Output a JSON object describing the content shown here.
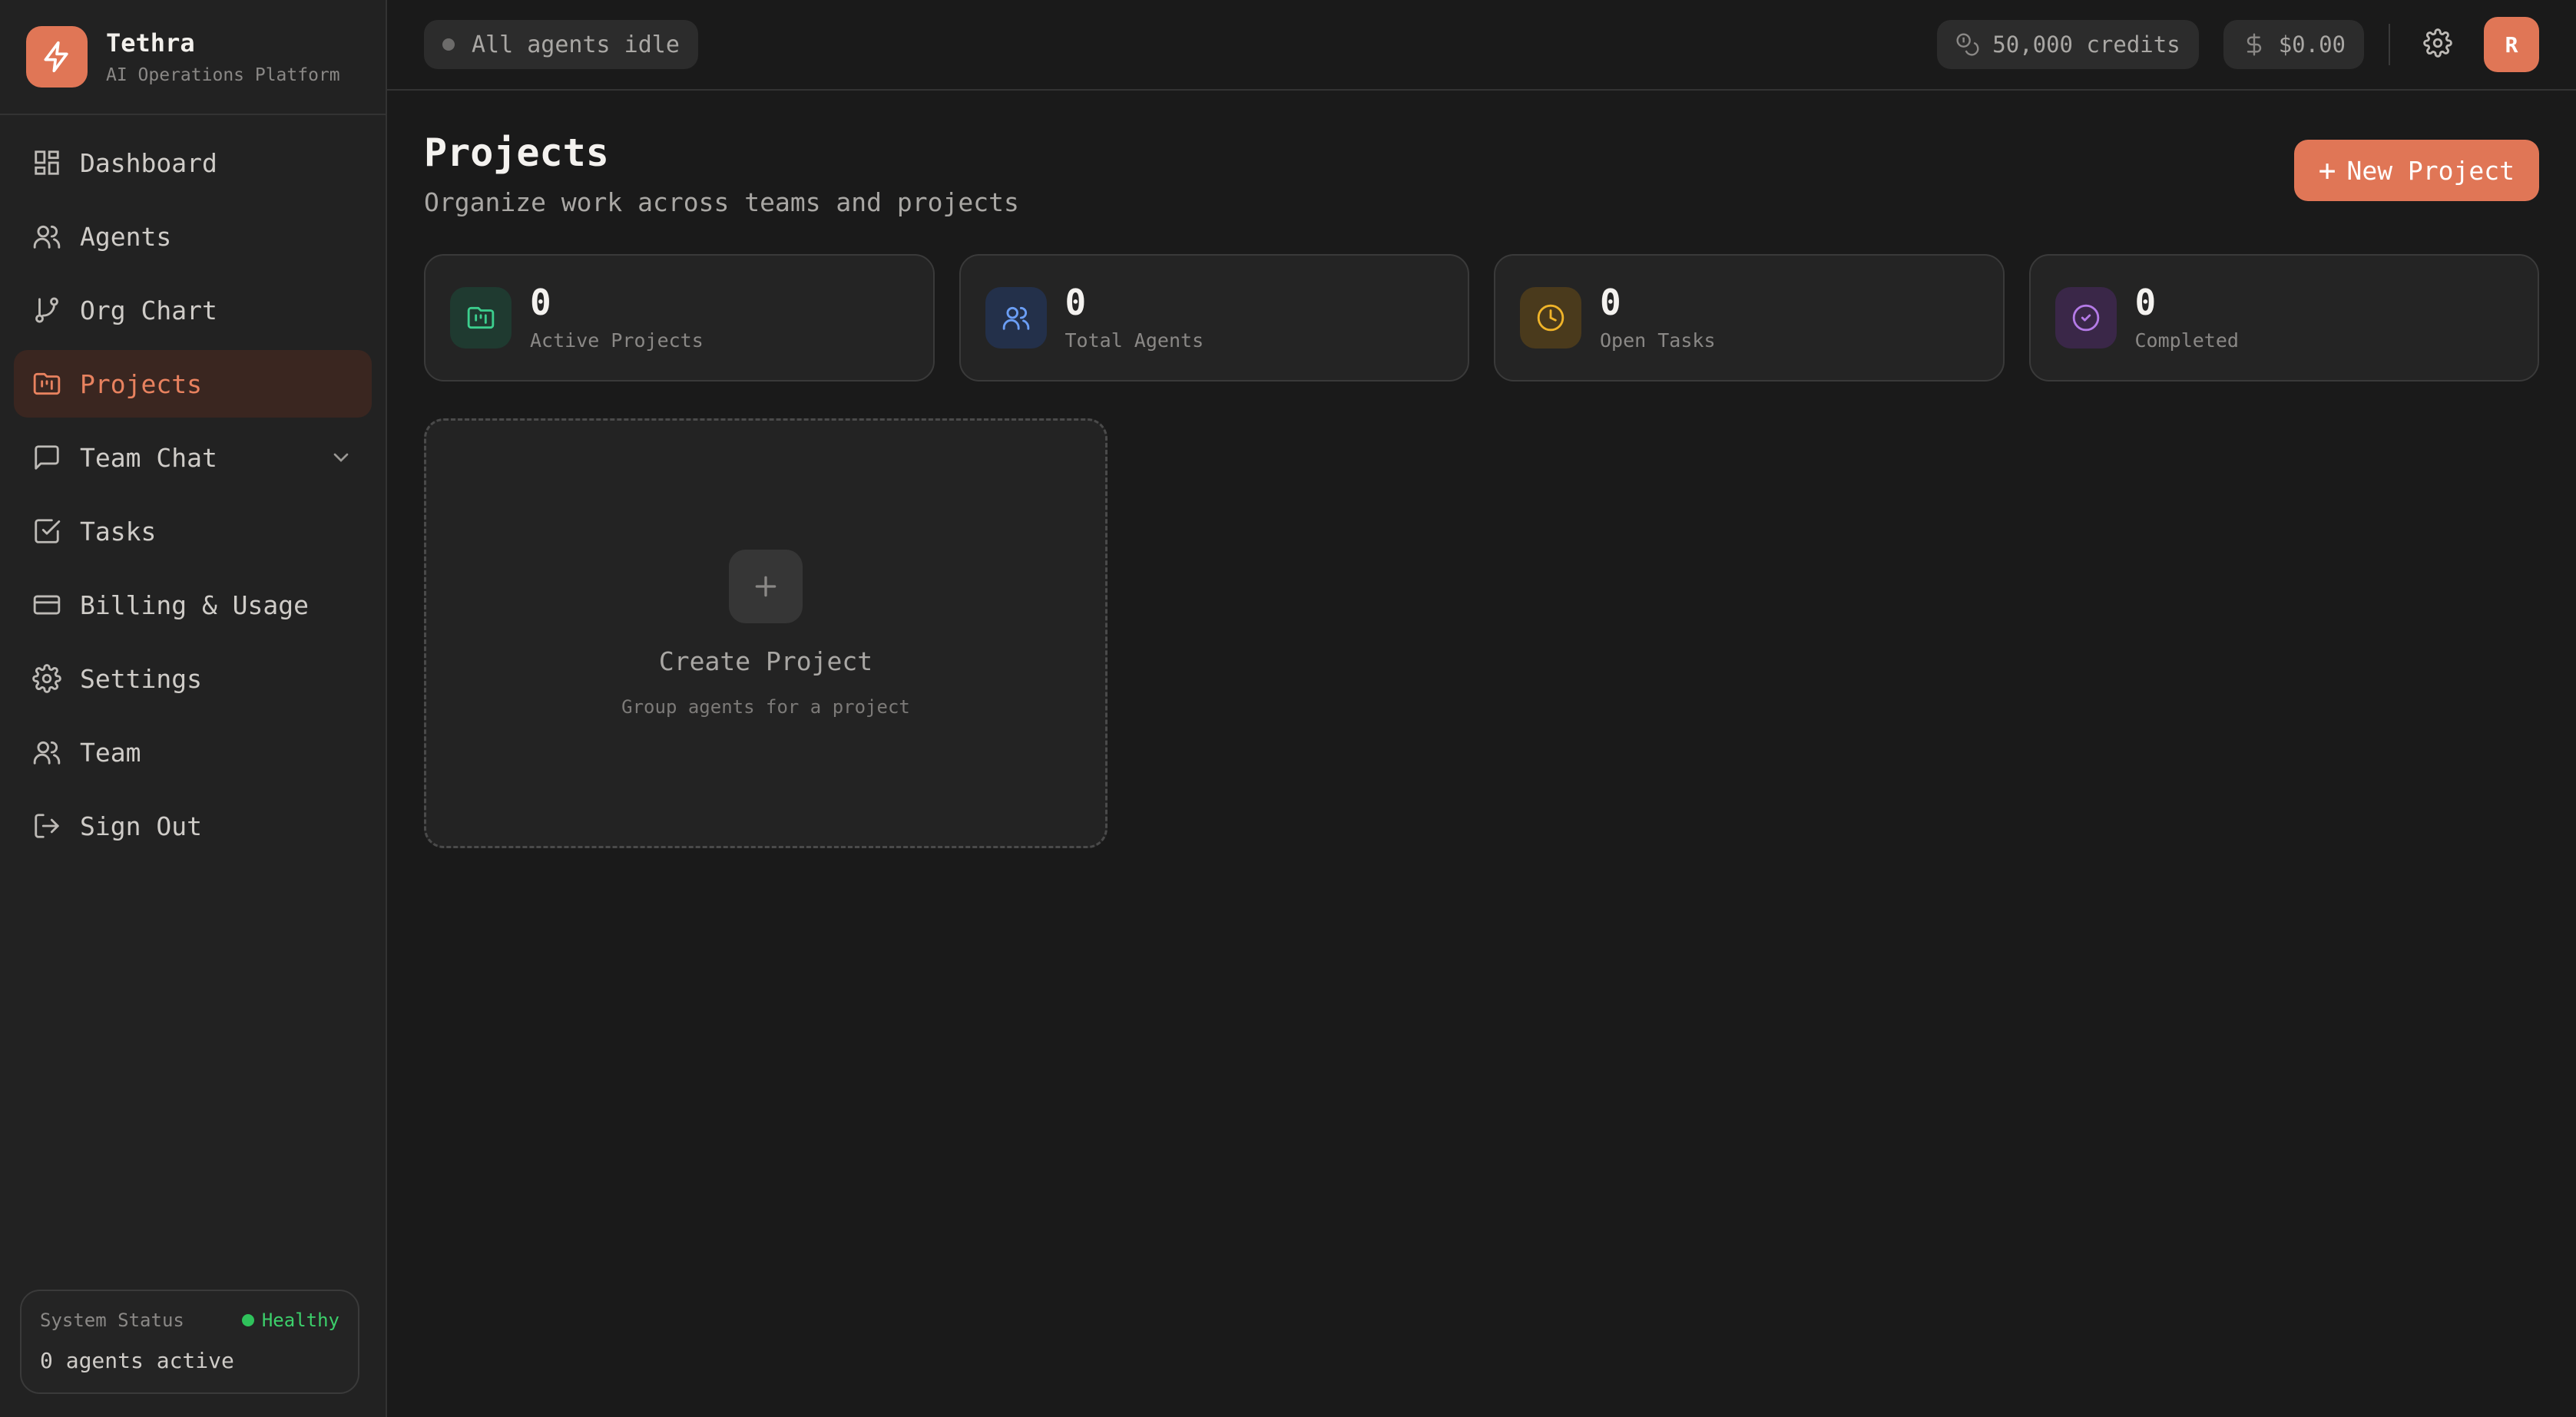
{
  "brand": {
    "name": "Tethra",
    "subtitle": "AI Operations Platform"
  },
  "nav": {
    "items": [
      {
        "label": "Dashboard",
        "icon": "dashboard-icon"
      },
      {
        "label": "Agents",
        "icon": "users-icon"
      },
      {
        "label": "Org Chart",
        "icon": "git-branch-icon"
      },
      {
        "label": "Projects",
        "icon": "folder-kanban-icon",
        "active": true
      },
      {
        "label": "Team Chat",
        "icon": "message-square-icon",
        "expandable": true
      },
      {
        "label": "Tasks",
        "icon": "check-square-icon"
      },
      {
        "label": "Billing & Usage",
        "icon": "credit-card-icon"
      },
      {
        "label": "Settings",
        "icon": "gear-icon"
      },
      {
        "label": "Team",
        "icon": "users-icon"
      },
      {
        "label": "Sign Out",
        "icon": "log-out-icon"
      }
    ]
  },
  "system_status": {
    "label": "System Status",
    "health": "Healthy",
    "agents": "0 agents active"
  },
  "topbar": {
    "agent_status": "All agents idle",
    "credits": "50,000 credits",
    "balance": "$0.00",
    "avatar_initial": "R"
  },
  "page": {
    "title": "Projects",
    "subtitle": "Organize work across teams and projects",
    "new_button": "New Project"
  },
  "stats": [
    {
      "value": "0",
      "label": "Active Projects",
      "icon": "folder-kanban-icon",
      "color": "#3ccf8e",
      "bg": "#1f3a30"
    },
    {
      "value": "0",
      "label": "Total Agents",
      "icon": "users-icon",
      "color": "#6b9ef5",
      "bg": "#23304a"
    },
    {
      "value": "0",
      "label": "Open Tasks",
      "icon": "clock-icon",
      "color": "#f0b429",
      "bg": "#4a3a1c"
    },
    {
      "value": "0",
      "label": "Completed",
      "icon": "check-circle-icon",
      "color": "#b47ae6",
      "bg": "#3a2748"
    }
  ],
  "create_card": {
    "title": "Create Project",
    "subtitle": "Group agents for a project"
  },
  "colors": {
    "accent": "#e07656",
    "background": "#1a1a1a",
    "sidebar": "#222222",
    "healthy": "#2fc25b"
  }
}
